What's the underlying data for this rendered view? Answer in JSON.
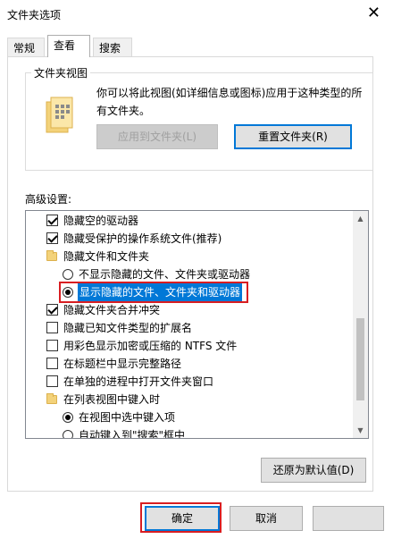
{
  "window": {
    "title": "文件夹选项",
    "close_glyph": "✕"
  },
  "tabs": [
    {
      "label": "常规",
      "active": false
    },
    {
      "label": "查看",
      "active": true
    },
    {
      "label": "搜索",
      "active": false
    }
  ],
  "folder_views": {
    "legend": "文件夹视图",
    "description": "你可以将此视图(如详细信息或图标)应用于这种类型的所有文件夹。",
    "apply_button": "应用到文件夹(L)",
    "reset_button": "重置文件夹(R)"
  },
  "advanced": {
    "label": "高级设置:",
    "items": [
      {
        "type": "checkbox",
        "checked": true,
        "label": "隐藏空的驱动器"
      },
      {
        "type": "checkbox",
        "checked": true,
        "label": "隐藏受保护的操作系统文件(推荐)"
      },
      {
        "type": "folder",
        "label": "隐藏文件和文件夹"
      },
      {
        "type": "radio",
        "checked": false,
        "label": "不显示隐藏的文件、文件夹或驱动器"
      },
      {
        "type": "radio",
        "checked": true,
        "label": "显示隐藏的文件、文件夹和驱动器"
      },
      {
        "type": "checkbox",
        "checked": true,
        "label": "隐藏文件夹合并冲突"
      },
      {
        "type": "checkbox",
        "checked": false,
        "label": "隐藏已知文件类型的扩展名"
      },
      {
        "type": "checkbox",
        "checked": false,
        "label": "用彩色显示加密或压缩的 NTFS 文件"
      },
      {
        "type": "checkbox",
        "checked": false,
        "label": "在标题栏中显示完整路径"
      },
      {
        "type": "checkbox",
        "checked": false,
        "label": "在单独的进程中打开文件夹窗口"
      },
      {
        "type": "folder",
        "label": "在列表视图中键入时"
      },
      {
        "type": "radio",
        "checked": true,
        "label": "在视图中选中键入项"
      },
      {
        "type": "radio",
        "checked": false,
        "label": "自动键入到\"搜索\"框中"
      }
    ]
  },
  "buttons": {
    "restore_defaults": "还原为默认值(D)",
    "ok": "确定",
    "cancel": "取消",
    "apply": ""
  },
  "icons": {
    "folder": "folder-icon",
    "scroll_up": "scroll-up-icon",
    "scroll_down": "scroll-down-icon",
    "close": "close-icon"
  },
  "colors": {
    "highlight": "#0078d7",
    "annotation_red": "#d81e22",
    "folder_yellow": "#f3d27a"
  }
}
